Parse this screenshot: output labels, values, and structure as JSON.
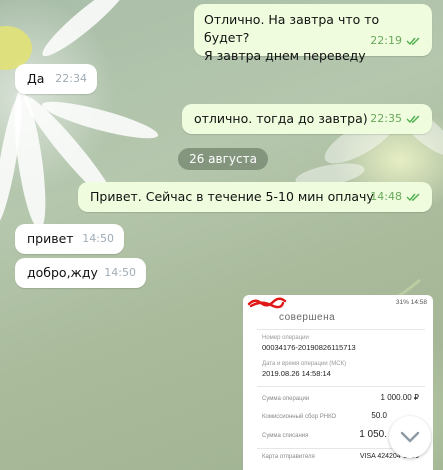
{
  "messages": [
    {
      "text_line1": "Отлично.  На завтра что то будет?",
      "text_line2": "Я завтра днем переведу",
      "time": "22:19",
      "read": true
    },
    {
      "text": "Да",
      "time": "22:34"
    },
    {
      "text": "отлично. тогда до завтра)",
      "time": "22:35",
      "read": true
    },
    {
      "text": "Привет. Сейчас в течение 5-10 мин оплачу",
      "time": "14:48",
      "read": true
    },
    {
      "text": "привет",
      "time": "14:50"
    },
    {
      "text": "добро,жду",
      "time": "14:50"
    }
  ],
  "date_separator": "26 августа",
  "receipt": {
    "status_bar": "31% 14:58",
    "title": "совершена",
    "op_number_label": "Номер операции",
    "op_number": "00034176-20190826115713",
    "datetime_label": "Дата и время операции (МСК)",
    "datetime": "2019.08.26 14:58:14",
    "amount_label": "Сумма операции",
    "amount": "1 000.00 ₽",
    "fee_label": "Комиссионный сбор РНКО",
    "fee": "50.0",
    "total_label": "Сумма списания",
    "total": "1 050.",
    "card_label": "Карта отправителя",
    "card": "VISA 424204*2439"
  },
  "colors": {
    "outgoing_bubble": "#effdde",
    "incoming_bubble": "#ffffff",
    "read_check": "#4fae4e",
    "date_pill": "#5c6e5a"
  },
  "icons": {
    "read_status": "double-check-icon",
    "scroll_down": "chevron-down-icon"
  }
}
